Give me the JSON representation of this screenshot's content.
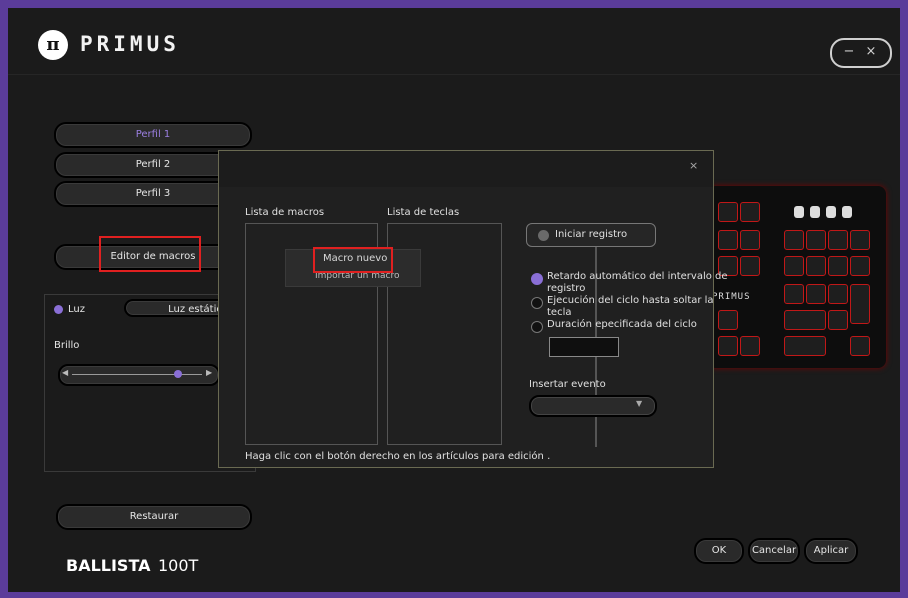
{
  "header": {
    "logo_symbol": "π",
    "logo_text": "PRIMUS",
    "minimize_symbol": "−",
    "close_symbol": "×"
  },
  "profiles": [
    {
      "label": "Perfil 1"
    },
    {
      "label": "Perfil 2"
    },
    {
      "label": "Perfil 3"
    }
  ],
  "macro_editor_label": "Editor de macros",
  "lighting": {
    "light_label": "Luz",
    "mode_label": "Luz estática",
    "brightness_label": "Brillo"
  },
  "keyboard": {
    "logo_text": "PRIMUS"
  },
  "dialog": {
    "close_symbol": "×",
    "macro_list_title": "Lista de macros",
    "key_list_title": "Lista de teclas",
    "context_menu": {
      "new_macro": "Macro nuevo",
      "import_macro": "Importar un macro"
    },
    "record_button": "Iniciar registro",
    "options": [
      {
        "label": "Retardo automático del intervalo de",
        "label2": "registro",
        "selected": true
      },
      {
        "label": "Ejecución del ciclo hasta soltar la",
        "label2": "tecla",
        "selected": false
      },
      {
        "label": "Duración epecificada del ciclo",
        "label2": "",
        "selected": false
      }
    ],
    "insert_event_label": "Insertar evento",
    "hint": "Haga clic con el botón derecho en los artículos para edición ."
  },
  "bottom": {
    "restore_label": "Restaurar",
    "brand_bold": "BALLISTA",
    "brand_model": "100T",
    "ok": "OK",
    "cancel": "Cancelar",
    "apply": "Aplicar"
  },
  "colors": {
    "accent": "#8a6fd6",
    "highlight": "#e02020",
    "frame": "#5b3c9a"
  }
}
